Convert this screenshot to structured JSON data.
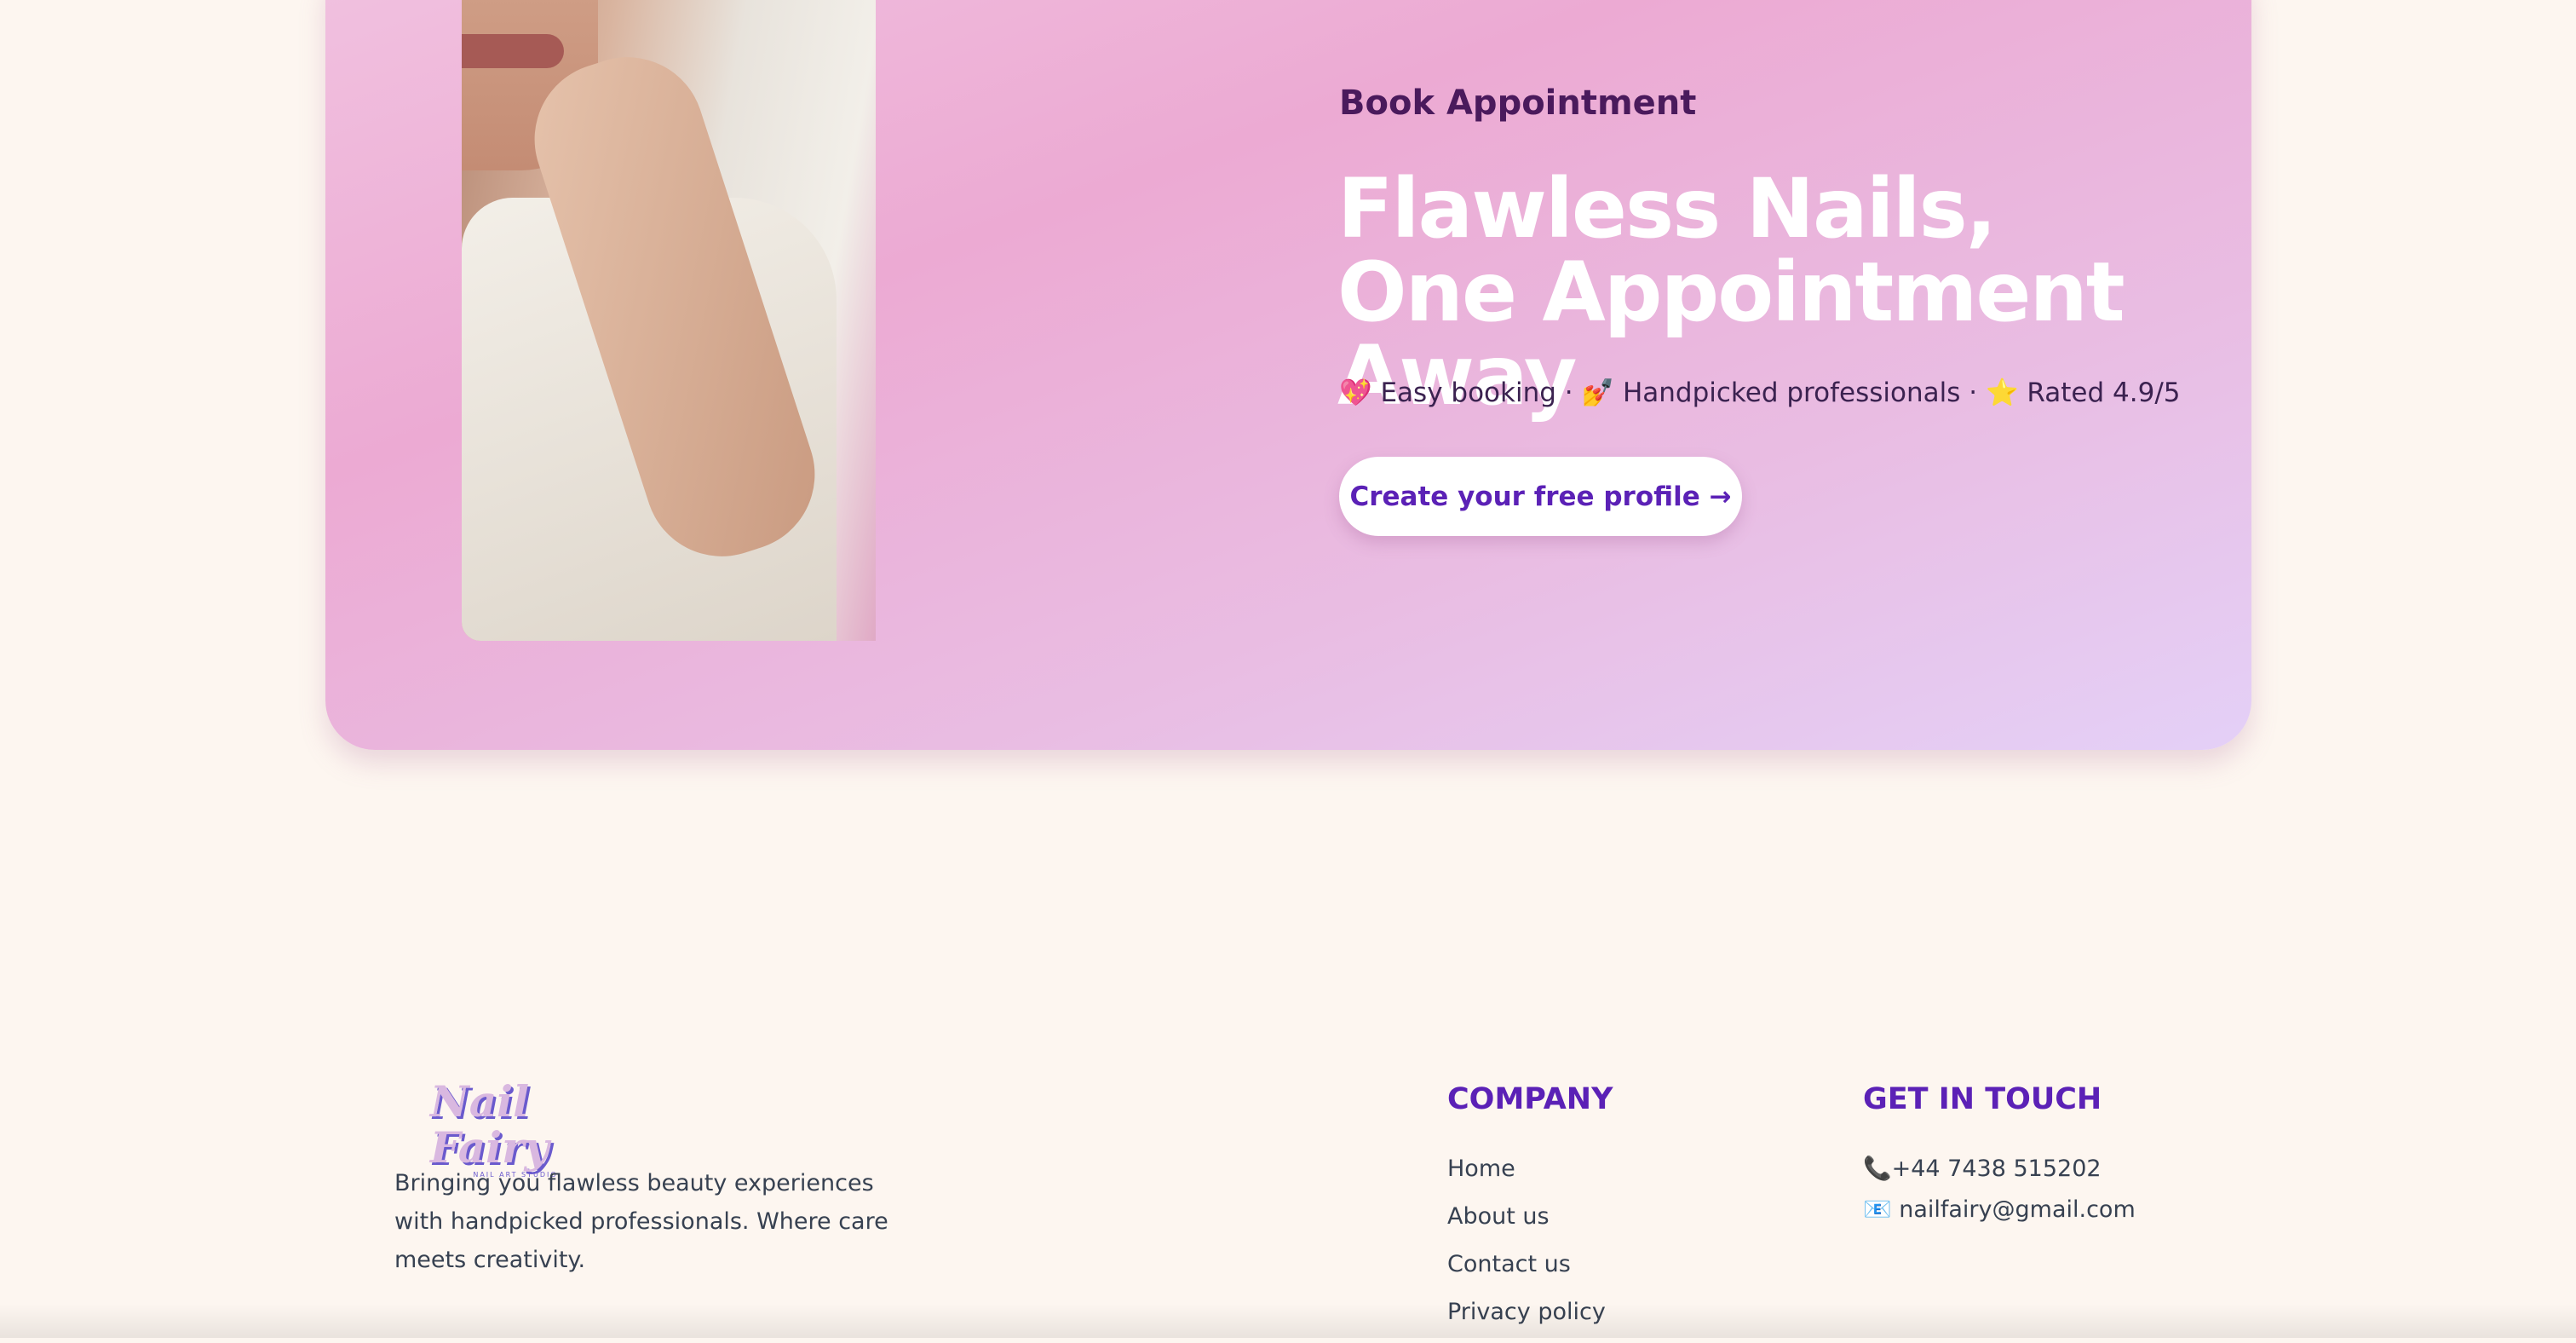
{
  "hero": {
    "eyebrow": "Book Appointment",
    "title_line1": "Flawless Nails,",
    "title_line2": "One Appointment Away",
    "features": [
      {
        "icon": "💖",
        "label": "Easy booking"
      },
      {
        "icon": "💅",
        "label": "Handpicked professionals"
      },
      {
        "icon": "⭐",
        "label": "Rated 4.9/5"
      }
    ],
    "separator": "·",
    "cta_label": "Create your free profile →"
  },
  "footer": {
    "logo_text": "Nail Fairy",
    "logo_tagline": "NAIL ART STUDIO",
    "description": "Bringing you flawless beauty experiences with handpicked professionals. Where care meets creativity.",
    "company_heading": "COMPANY",
    "company_links": [
      "Home",
      "About us",
      "Contact us",
      "Privacy policy"
    ],
    "contact_heading": "GET IN TOUCH",
    "phone_icon": "📞",
    "phone": "+44 7438 515202",
    "email_icon": "📧",
    "email": "nailfairy@gmail.com"
  },
  "colors": {
    "accent": "#5b21b6",
    "heading_dark": "#4a1a5c",
    "background": "#fdf6f0"
  }
}
